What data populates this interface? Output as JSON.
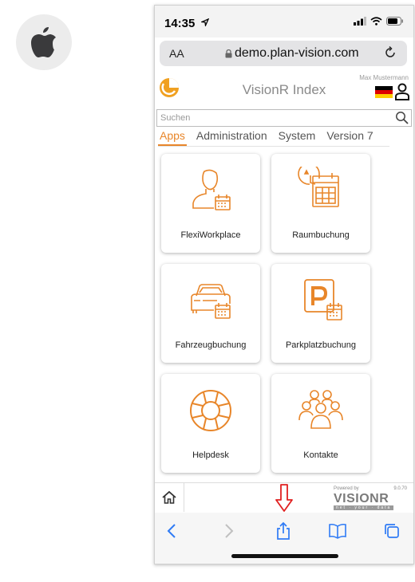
{
  "status": {
    "time": "14:35"
  },
  "browser": {
    "text_size": "AA",
    "url": "demo.plan-vision.com"
  },
  "app": {
    "title": "VisionR Index",
    "user": "Max Mustermann"
  },
  "search": {
    "placeholder": "Suchen"
  },
  "tabs": [
    {
      "label": "Apps",
      "active": true
    },
    {
      "label": "Administration",
      "active": false
    },
    {
      "label": "System",
      "active": false
    },
    {
      "label": "Version 7",
      "active": false
    }
  ],
  "tiles": [
    {
      "label": "FlexiWorkplace",
      "icon": "person-calendar-icon"
    },
    {
      "label": "Raumbuchung",
      "icon": "clock-calendar-icon"
    },
    {
      "label": "Fahrzeugbuchung",
      "icon": "car-calendar-icon"
    },
    {
      "label": "Parkplatzbuchung",
      "icon": "parking-calendar-icon"
    },
    {
      "label": "Helpdesk",
      "icon": "lifebuoy-icon"
    },
    {
      "label": "Kontakte",
      "icon": "group-icon"
    }
  ],
  "footer": {
    "powered_by": "Powered by",
    "version": "9.0.70",
    "brand": "VISIONR",
    "tagline": "net · your · data"
  },
  "colors": {
    "accent": "#e8862a",
    "toolbar_icon": "#2f7bf5",
    "share_arrow": "#e02020"
  }
}
